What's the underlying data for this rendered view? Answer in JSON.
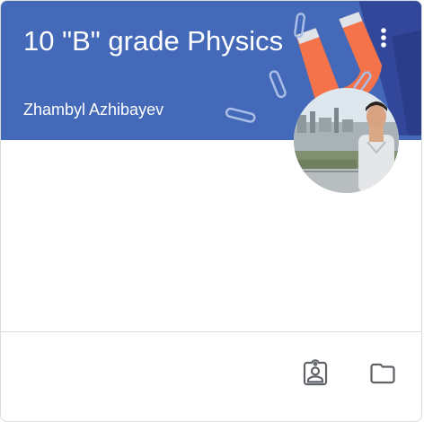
{
  "class_card": {
    "title": "10 \"B\" grade Physics",
    "teacher": "Zhambyl Azhibayev",
    "header_color": "#4369b8",
    "theme_icons": [
      "magnet-icon",
      "paperclip-icon"
    ],
    "menu_icon": "more-vert-icon",
    "footer_actions": [
      {
        "icon": "assignment-ind-icon"
      },
      {
        "icon": "folder-icon"
      }
    ]
  }
}
